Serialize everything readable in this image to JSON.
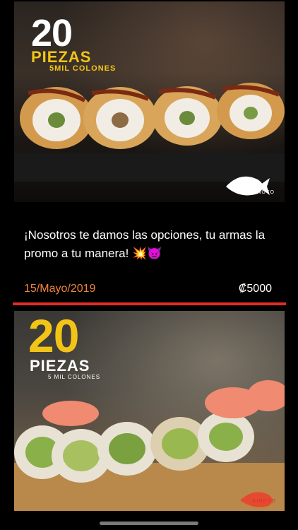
{
  "posts": [
    {
      "image": {
        "number": "20",
        "word": "PIEZAS",
        "subtitle": "5MIL COLONES",
        "brand": "KINGYO"
      },
      "text": "¡Nosotros te damos las opciones, tu armas la promo a tu manera! 💥😈",
      "date": "15/Mayo/2019",
      "price": "₡5000",
      "accent_color": "#e32b25"
    },
    {
      "image": {
        "number": "20",
        "word": "PIEZAS",
        "subtitle": "5 MIL COLONES",
        "brand": "KINGYO"
      }
    }
  ]
}
